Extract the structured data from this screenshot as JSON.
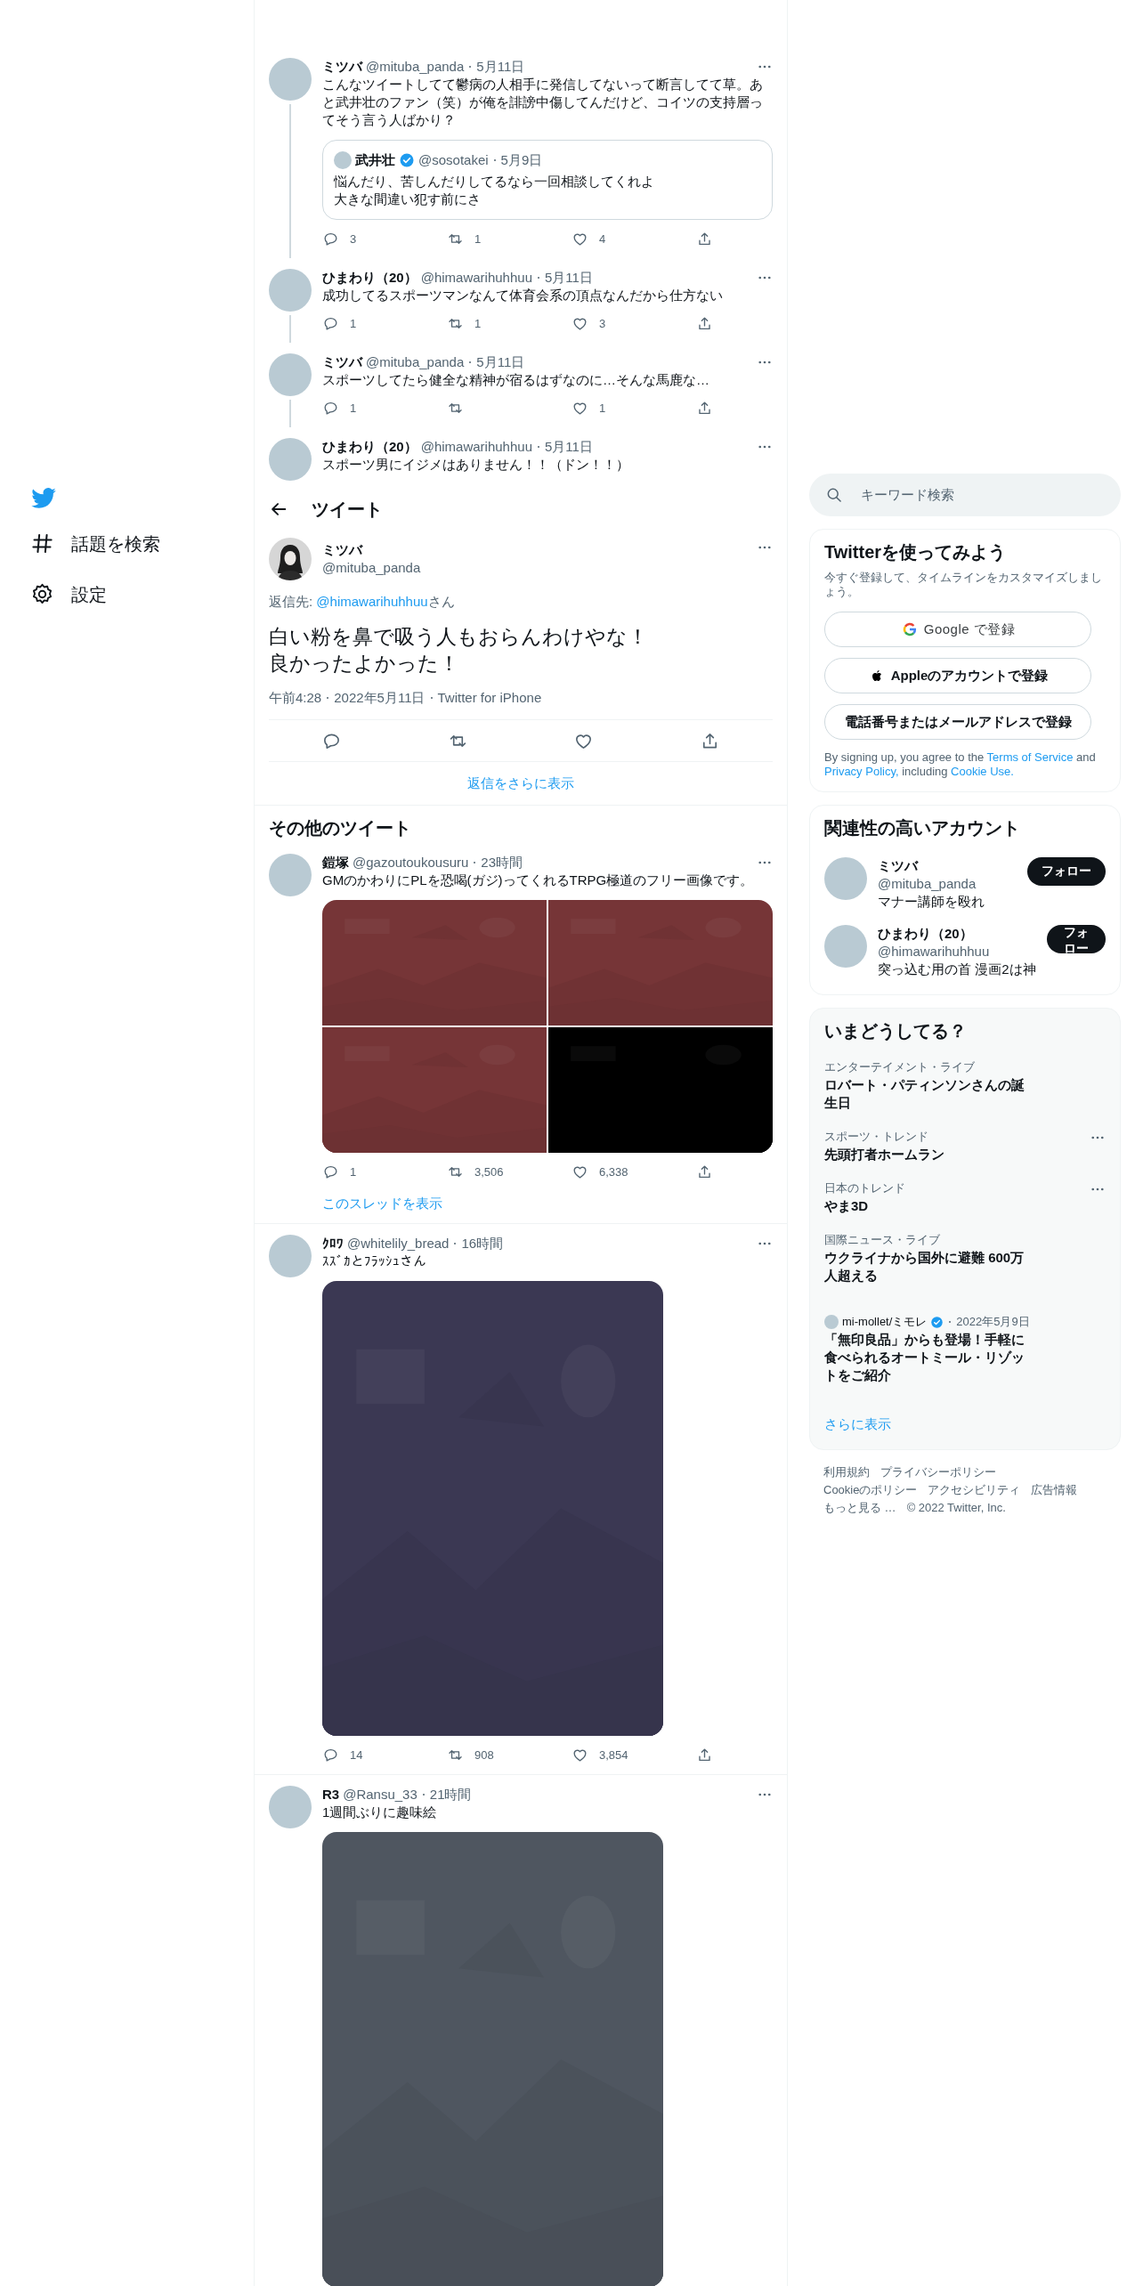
{
  "sidebar": {
    "items": [
      {
        "kind": "explore",
        "label": "話題を検索"
      },
      {
        "kind": "settings",
        "label": "設定"
      }
    ]
  },
  "thread": [
    {
      "name": "ミツバ",
      "handle": "@mituba_panda",
      "time": "5月11日",
      "text": "こんなツイートしてて鬱病の人相手に発信してないって断言してて草。あと武井壮のファン（笑）が俺を誹謗中傷してんだけど、コイツの支持層ってそう言う人ばかり？",
      "quote": {
        "name": "武井壮",
        "verified": true,
        "handle": "@sosotakei",
        "time": "5月9日",
        "text": [
          "悩んだり、苦しんだりしてるなら一回相談してくれよ",
          "大きな間違い犯す前にさ"
        ]
      },
      "replies": "3",
      "retweets": "1",
      "likes": "4"
    },
    {
      "name": "ひまわり（20）",
      "handle": "@himawarihuhhuu",
      "time": "5月11日",
      "text": "成功してるスポーツマンなんて体育会系の頂点なんだから仕方ない",
      "replies": "1",
      "retweets": "1",
      "likes": "3"
    },
    {
      "name": "ミツバ",
      "handle": "@mituba_panda",
      "time": "5月11日",
      "text": "スポーツしてたら健全な精神が宿るはずなのに…そんな馬鹿な…",
      "replies": "1",
      "likes": "1"
    },
    {
      "name": "ひまわり（20）",
      "handle": "@himawarihuhhuu",
      "time": "5月11日",
      "text": "スポーツ男にイジメはありません！！（ドン！！）"
    }
  ],
  "header": {
    "title": "ツイート"
  },
  "main_tweet": {
    "name": "ミツバ",
    "handle": "@mituba_panda",
    "reply_prefix": "返信先: ",
    "reply_handle": "@himawarihuhhuu",
    "reply_suffix": "さん",
    "text": [
      "白い粉を鼻で吸う人もおらんわけやな！",
      "良かったよかった！"
    ],
    "time": "午前4:28",
    "date": "2022年5月11日",
    "source": "Twitter for iPhone"
  },
  "show_more_replies": "返信をさらに表示",
  "more_tweets": {
    "title": "その他のツイート",
    "tweets": [
      {
        "name": "鎧塚",
        "handle": "@gazoutoukousuru",
        "time": "23時間",
        "text": "GMのかわりにPLを恐喝(ガジ)ってくれるTRPG極道のフリー画像です。",
        "replies": "1",
        "retweets": "3,506",
        "likes": "6,338",
        "thread_link": "このスレッドを表示"
      },
      {
        "name": "ｸﾛﾜ",
        "handle": "@whitelily_bread",
        "time": "16時間",
        "text": "ｽｽﾞｶとﾌﾗｯｼｭさん",
        "replies": "14",
        "retweets": "908",
        "likes": "3,854"
      },
      {
        "name": "R3",
        "handle": "@Ransu_33",
        "time": "21時間",
        "text": "1週間ぶりに趣味絵"
      }
    ]
  },
  "search": {
    "placeholder": "キーワード検索"
  },
  "signup": {
    "title": "Twitterを使ってみよう",
    "description": "今すぐ登録して、タイムラインをカスタマイズしましょう。",
    "buttons": [
      {
        "kind": "google",
        "label": "Google で登録"
      },
      {
        "kind": "apple",
        "label": "Appleのアカウントで登録"
      },
      {
        "kind": "phone",
        "label": "電話番号またはメールアドレスで登録"
      }
    ],
    "legal": [
      {
        "text": "By signing up, you agree to the ",
        "link": false
      },
      {
        "text": "Terms of Service",
        "link": true
      },
      {
        "text": " and ",
        "link": false
      },
      {
        "text": "Privacy Policy,",
        "link": true
      },
      {
        "text": " including ",
        "link": false
      },
      {
        "text": "Cookie Use.",
        "link": true
      }
    ]
  },
  "who_to_follow": {
    "title": "関連性の高いアカウント",
    "accounts": [
      {
        "name": "ミツバ",
        "handle": "@mituba_panda",
        "bio": "マナー講師を殴れ",
        "button": "フォロー"
      },
      {
        "name": "ひまわり（20）",
        "handle": "@himawarihuhhuu",
        "bio": "突っ込む用の首 漫画2は神",
        "button": "フォロー"
      }
    ]
  },
  "trends": {
    "title": "いまどうしてる？",
    "items": [
      {
        "kind": "trend",
        "category": "エンターテイメント・ライブ",
        "title": "ロバート・パティンソンさんの誕生日",
        "more": false
      },
      {
        "kind": "trend",
        "category": "スポーツ・トレンド",
        "title": "先頭打者ホームラン",
        "more": true
      },
      {
        "kind": "trend",
        "category": "日本のトレンド",
        "title": "やま3D",
        "more": true
      },
      {
        "kind": "trend",
        "category": "国際ニュース・ライブ",
        "title": "ウクライナから国外に避難 600万人超える",
        "more": false
      },
      {
        "kind": "news",
        "source": "mi-mollet/ミモレ",
        "verified": true,
        "time": "2022年5月9日",
        "title": "「無印良品」からも登場！手軽に食べられるオートミール・リゾットをご紹介"
      }
    ],
    "show_more": "さらに表示"
  },
  "footer": {
    "links": [
      "利用規約",
      "プライバシーポリシー",
      "Cookieのポリシー",
      "アクセシビリティ",
      "広告情報",
      "もっと見る …"
    ],
    "copyright": "© 2022 Twitter, Inc."
  }
}
